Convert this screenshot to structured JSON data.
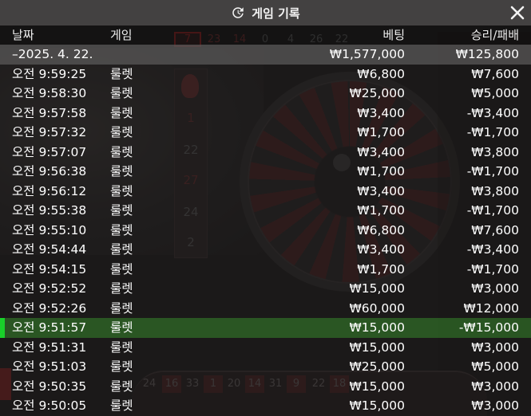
{
  "header": {
    "title": "게임 기록",
    "history_icon": "history-clock-icon",
    "close_icon": "close-x-icon"
  },
  "columns": {
    "date": "날짜",
    "game": "게임",
    "bet": "베팅",
    "result": "승리/패배"
  },
  "summary": {
    "date": "–2025. 4. 22.",
    "bet": "₩1,577,000",
    "result": "₩125,800"
  },
  "rows": [
    {
      "time": "오전 9:59:25",
      "game": "룰렛",
      "bet": "₩6,800",
      "result": "₩7,600"
    },
    {
      "time": "오전 9:58:30",
      "game": "룰렛",
      "bet": "₩25,000",
      "result": "₩5,000"
    },
    {
      "time": "오전 9:57:58",
      "game": "룰렛",
      "bet": "₩3,400",
      "result": "-₩3,400"
    },
    {
      "time": "오전 9:57:32",
      "game": "룰렛",
      "bet": "₩1,700",
      "result": "-₩1,700"
    },
    {
      "time": "오전 9:57:07",
      "game": "룰렛",
      "bet": "₩3,400",
      "result": "₩3,800"
    },
    {
      "time": "오전 9:56:38",
      "game": "룰렛",
      "bet": "₩1,700",
      "result": "-₩1,700"
    },
    {
      "time": "오전 9:56:12",
      "game": "룰렛",
      "bet": "₩3,400",
      "result": "₩3,800"
    },
    {
      "time": "오전 9:55:38",
      "game": "룰렛",
      "bet": "₩1,700",
      "result": "-₩1,700"
    },
    {
      "time": "오전 9:55:10",
      "game": "룰렛",
      "bet": "₩6,800",
      "result": "₩7,600"
    },
    {
      "time": "오전 9:54:44",
      "game": "룰렛",
      "bet": "₩3,400",
      "result": "-₩3,400"
    },
    {
      "time": "오전 9:54:15",
      "game": "룰렛",
      "bet": "₩1,700",
      "result": "-₩1,700"
    },
    {
      "time": "오전 9:52:52",
      "game": "룰렛",
      "bet": "₩15,000",
      "result": "₩3,000"
    },
    {
      "time": "오전 9:52:26",
      "game": "룰렛",
      "bet": "₩60,000",
      "result": "₩12,000"
    },
    {
      "time": "오전 9:51:57",
      "game": "룰렛",
      "bet": "₩15,000",
      "result": "-₩15,000",
      "highlighted": true
    },
    {
      "time": "오전 9:51:31",
      "game": "룰렛",
      "bet": "₩15,000",
      "result": "₩3,000"
    },
    {
      "time": "오전 9:51:03",
      "game": "룰렛",
      "bet": "₩25,000",
      "result": "₩5,000"
    },
    {
      "time": "오전 9:50:35",
      "game": "룰렛",
      "bet": "₩15,000",
      "result": "₩3,000"
    },
    {
      "time": "오전 9:50:05",
      "game": "룰렛",
      "bet": "₩15,000",
      "result": "₩3,000"
    }
  ],
  "colors": {
    "highlight_row": "#2e6826",
    "highlight_marker": "#19d12a",
    "header_bg": "#464444",
    "summary_bg": "#504e4e"
  }
}
